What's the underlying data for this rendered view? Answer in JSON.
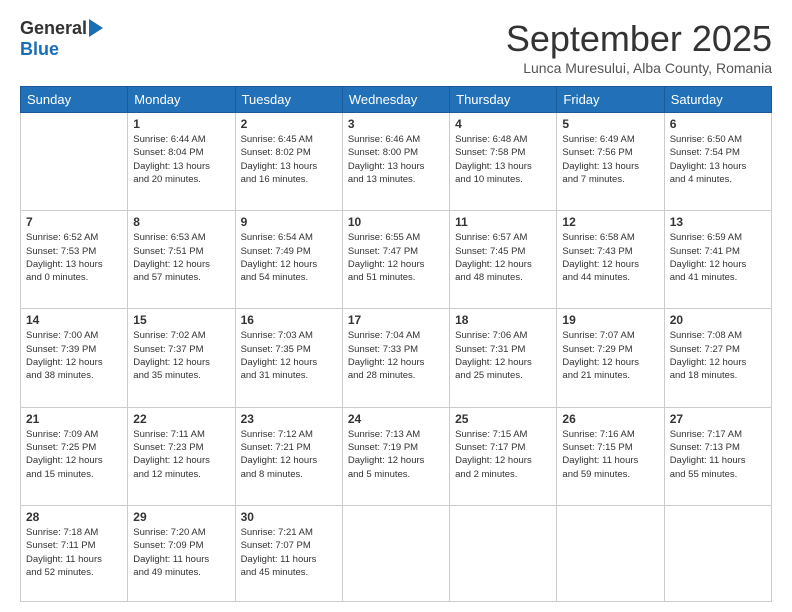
{
  "logo": {
    "general": "General",
    "blue": "Blue"
  },
  "title": "September 2025",
  "subtitle": "Lunca Muresului, Alba County, Romania",
  "weekdays": [
    "Sunday",
    "Monday",
    "Tuesday",
    "Wednesday",
    "Thursday",
    "Friday",
    "Saturday"
  ],
  "weeks": [
    [
      {
        "day": "",
        "detail": ""
      },
      {
        "day": "1",
        "detail": "Sunrise: 6:44 AM\nSunset: 8:04 PM\nDaylight: 13 hours\nand 20 minutes."
      },
      {
        "day": "2",
        "detail": "Sunrise: 6:45 AM\nSunset: 8:02 PM\nDaylight: 13 hours\nand 16 minutes."
      },
      {
        "day": "3",
        "detail": "Sunrise: 6:46 AM\nSunset: 8:00 PM\nDaylight: 13 hours\nand 13 minutes."
      },
      {
        "day": "4",
        "detail": "Sunrise: 6:48 AM\nSunset: 7:58 PM\nDaylight: 13 hours\nand 10 minutes."
      },
      {
        "day": "5",
        "detail": "Sunrise: 6:49 AM\nSunset: 7:56 PM\nDaylight: 13 hours\nand 7 minutes."
      },
      {
        "day": "6",
        "detail": "Sunrise: 6:50 AM\nSunset: 7:54 PM\nDaylight: 13 hours\nand 4 minutes."
      }
    ],
    [
      {
        "day": "7",
        "detail": "Sunrise: 6:52 AM\nSunset: 7:53 PM\nDaylight: 13 hours\nand 0 minutes."
      },
      {
        "day": "8",
        "detail": "Sunrise: 6:53 AM\nSunset: 7:51 PM\nDaylight: 12 hours\nand 57 minutes."
      },
      {
        "day": "9",
        "detail": "Sunrise: 6:54 AM\nSunset: 7:49 PM\nDaylight: 12 hours\nand 54 minutes."
      },
      {
        "day": "10",
        "detail": "Sunrise: 6:55 AM\nSunset: 7:47 PM\nDaylight: 12 hours\nand 51 minutes."
      },
      {
        "day": "11",
        "detail": "Sunrise: 6:57 AM\nSunset: 7:45 PM\nDaylight: 12 hours\nand 48 minutes."
      },
      {
        "day": "12",
        "detail": "Sunrise: 6:58 AM\nSunset: 7:43 PM\nDaylight: 12 hours\nand 44 minutes."
      },
      {
        "day": "13",
        "detail": "Sunrise: 6:59 AM\nSunset: 7:41 PM\nDaylight: 12 hours\nand 41 minutes."
      }
    ],
    [
      {
        "day": "14",
        "detail": "Sunrise: 7:00 AM\nSunset: 7:39 PM\nDaylight: 12 hours\nand 38 minutes."
      },
      {
        "day": "15",
        "detail": "Sunrise: 7:02 AM\nSunset: 7:37 PM\nDaylight: 12 hours\nand 35 minutes."
      },
      {
        "day": "16",
        "detail": "Sunrise: 7:03 AM\nSunset: 7:35 PM\nDaylight: 12 hours\nand 31 minutes."
      },
      {
        "day": "17",
        "detail": "Sunrise: 7:04 AM\nSunset: 7:33 PM\nDaylight: 12 hours\nand 28 minutes."
      },
      {
        "day": "18",
        "detail": "Sunrise: 7:06 AM\nSunset: 7:31 PM\nDaylight: 12 hours\nand 25 minutes."
      },
      {
        "day": "19",
        "detail": "Sunrise: 7:07 AM\nSunset: 7:29 PM\nDaylight: 12 hours\nand 21 minutes."
      },
      {
        "day": "20",
        "detail": "Sunrise: 7:08 AM\nSunset: 7:27 PM\nDaylight: 12 hours\nand 18 minutes."
      }
    ],
    [
      {
        "day": "21",
        "detail": "Sunrise: 7:09 AM\nSunset: 7:25 PM\nDaylight: 12 hours\nand 15 minutes."
      },
      {
        "day": "22",
        "detail": "Sunrise: 7:11 AM\nSunset: 7:23 PM\nDaylight: 12 hours\nand 12 minutes."
      },
      {
        "day": "23",
        "detail": "Sunrise: 7:12 AM\nSunset: 7:21 PM\nDaylight: 12 hours\nand 8 minutes."
      },
      {
        "day": "24",
        "detail": "Sunrise: 7:13 AM\nSunset: 7:19 PM\nDaylight: 12 hours\nand 5 minutes."
      },
      {
        "day": "25",
        "detail": "Sunrise: 7:15 AM\nSunset: 7:17 PM\nDaylight: 12 hours\nand 2 minutes."
      },
      {
        "day": "26",
        "detail": "Sunrise: 7:16 AM\nSunset: 7:15 PM\nDaylight: 11 hours\nand 59 minutes."
      },
      {
        "day": "27",
        "detail": "Sunrise: 7:17 AM\nSunset: 7:13 PM\nDaylight: 11 hours\nand 55 minutes."
      }
    ],
    [
      {
        "day": "28",
        "detail": "Sunrise: 7:18 AM\nSunset: 7:11 PM\nDaylight: 11 hours\nand 52 minutes."
      },
      {
        "day": "29",
        "detail": "Sunrise: 7:20 AM\nSunset: 7:09 PM\nDaylight: 11 hours\nand 49 minutes."
      },
      {
        "day": "30",
        "detail": "Sunrise: 7:21 AM\nSunset: 7:07 PM\nDaylight: 11 hours\nand 45 minutes."
      },
      {
        "day": "",
        "detail": ""
      },
      {
        "day": "",
        "detail": ""
      },
      {
        "day": "",
        "detail": ""
      },
      {
        "day": "",
        "detail": ""
      }
    ]
  ]
}
